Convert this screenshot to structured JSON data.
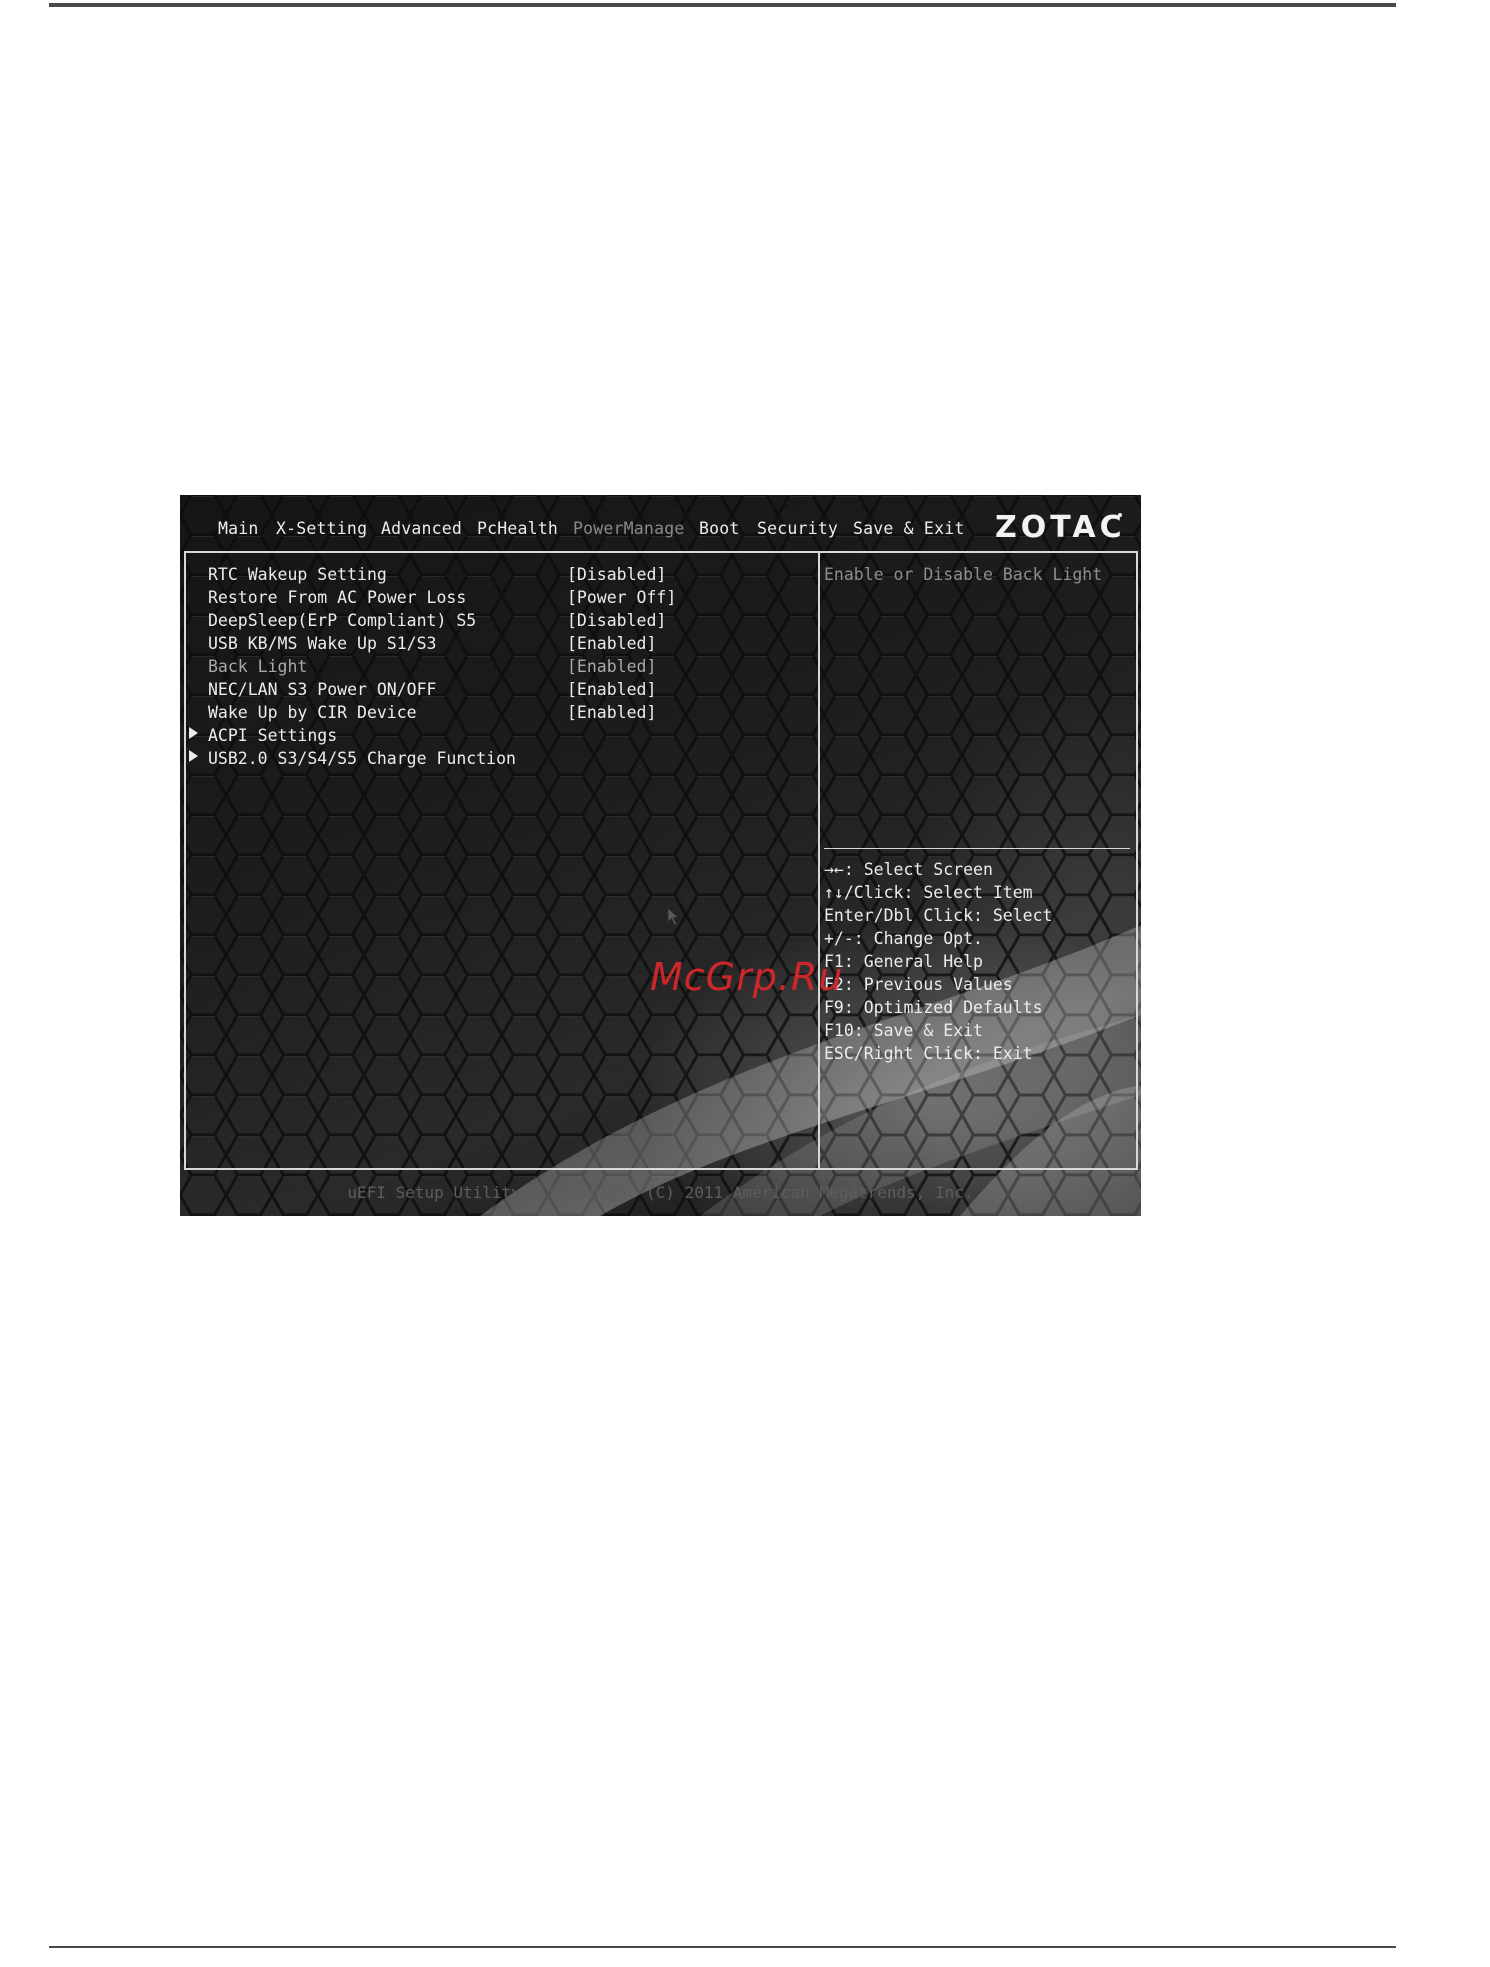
{
  "menu": {
    "tabs": [
      {
        "label": "Main"
      },
      {
        "label": "X-Setting"
      },
      {
        "label": "Advanced"
      },
      {
        "label": "PcHealth"
      },
      {
        "label": "PowerManage",
        "active": true
      },
      {
        "label": "Boot"
      },
      {
        "label": "Security"
      },
      {
        "label": "Save & Exit"
      }
    ],
    "brand": "ZOTAC"
  },
  "settings": [
    {
      "label": "RTC Wakeup Setting",
      "value": "[Disabled]"
    },
    {
      "label": "Restore From AC Power Loss",
      "value": "[Power Off]"
    },
    {
      "label": "DeepSleep(ErP Compliant) S5",
      "value": "[Disabled]"
    },
    {
      "label": "USB KB/MS Wake Up S1/S3",
      "value": "[Enabled]"
    },
    {
      "label": "Back Light",
      "value": "[Enabled]",
      "selected": true
    },
    {
      "label": "NEC/LAN S3 Power ON/OFF",
      "value": "[Enabled]"
    },
    {
      "label": "Wake Up by CIR Device",
      "value": "[Enabled]"
    },
    {
      "label": "ACPI Settings",
      "submenu": true
    },
    {
      "label": "USB2.0 S3/S4/S5 Charge Function",
      "submenu": true
    }
  ],
  "help": {
    "description": "Enable or Disable Back Light",
    "keys": [
      "→←: Select Screen",
      "↑↓/Click: Select Item",
      "Enter/Dbl Click: Select",
      "+/-: Change Opt.",
      "F1: General Help",
      "F2: Previous Values",
      "F9: Optimized Defaults",
      "F10: Save & Exit",
      "ESC/Right Click: Exit"
    ]
  },
  "footer": "uEFI Setup Utility - Copyright (C) 2011 American Megatrends, Inc.",
  "watermark": "McGrp.Ru"
}
